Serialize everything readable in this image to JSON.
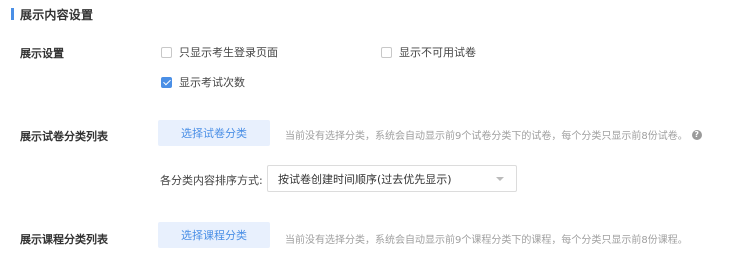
{
  "section": {
    "title": "展示内容设置"
  },
  "display_settings": {
    "label": "展示设置",
    "options": [
      {
        "label": "只显示考生登录页面",
        "checked": false
      },
      {
        "label": "显示不可用试卷",
        "checked": false
      },
      {
        "label": "显示考试次数",
        "checked": true
      }
    ]
  },
  "exam_category": {
    "label": "展示试卷分类列表",
    "button_label": "选择试卷分类",
    "hint": "当前没有选择分类，系统会自动显示前9个试卷分类下的试卷，每个分类只显示前8份试卷。",
    "help_icon": "?",
    "sort_label": "各分类内容排序方式:",
    "sort_value": "按试卷创建时间顺序(过去优先显示)"
  },
  "course_category": {
    "label": "展示课程分类列表",
    "button_label": "选择课程分类",
    "hint": "当前没有选择分类，系统会自动显示前9个课程分类下的课程，每个分类只显示前8份课程。"
  },
  "colors": {
    "accent": "#4a8fe6",
    "button_bg": "#e8f0fd",
    "hint": "#a0a0a0"
  }
}
